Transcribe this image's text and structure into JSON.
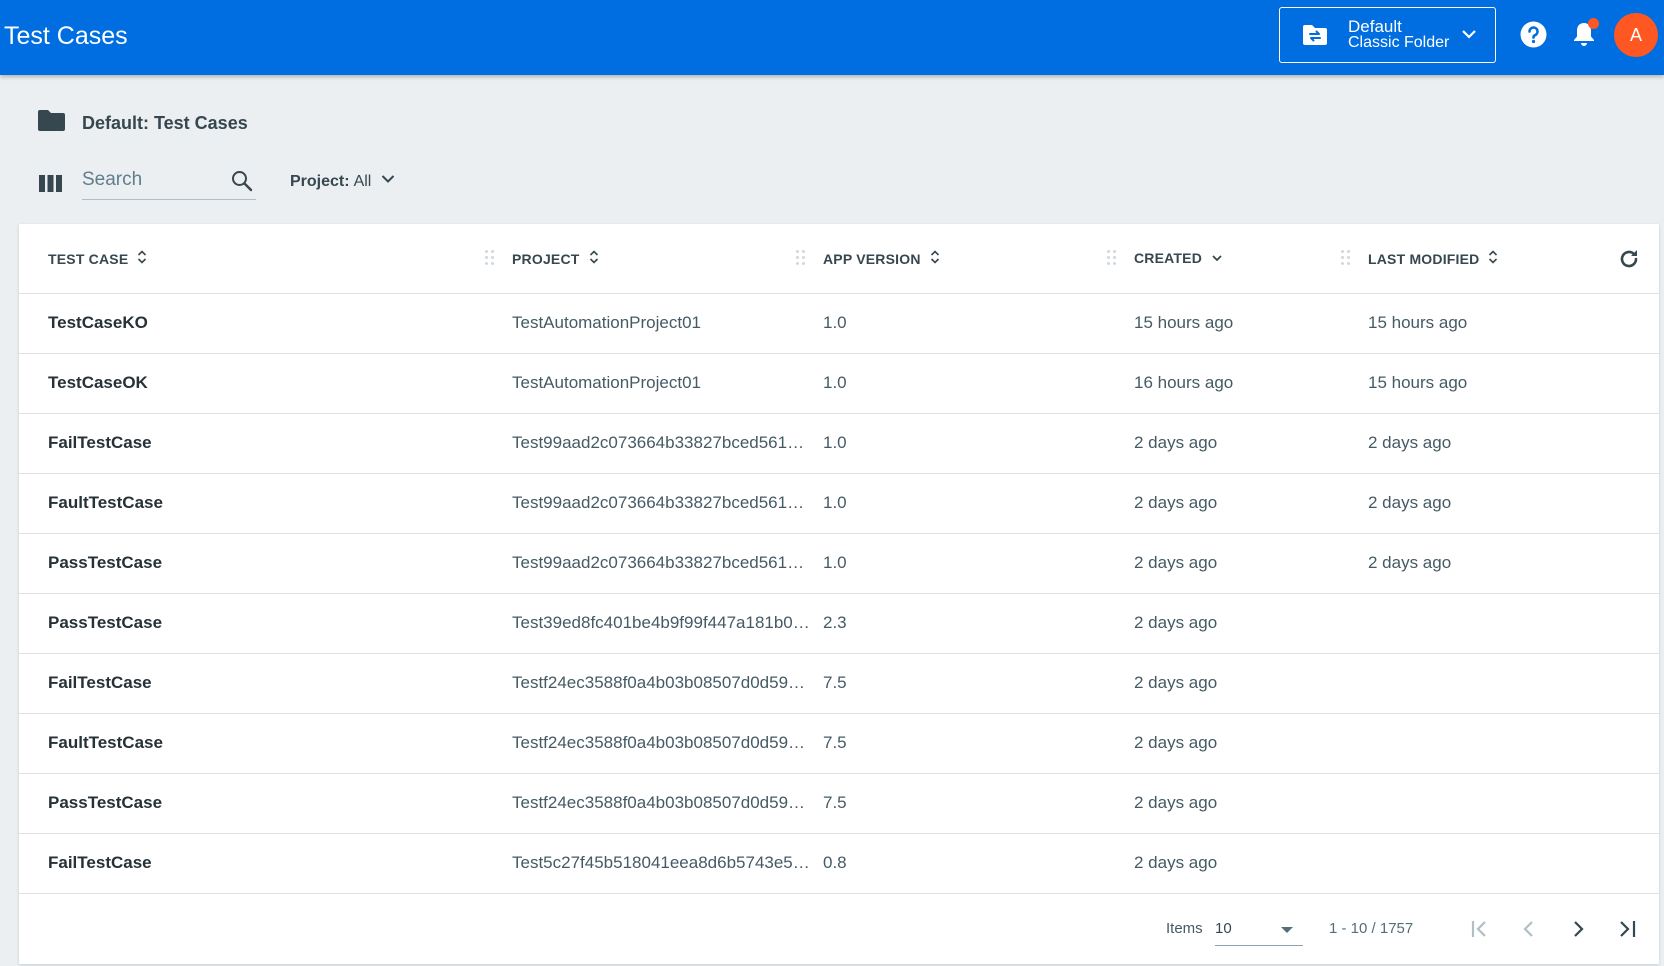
{
  "header": {
    "title": "Test Cases",
    "folder_switch": {
      "line1": "Default",
      "line2": "Classic Folder"
    },
    "avatar_initial": "A"
  },
  "breadcrumb": {
    "title": "Default: Test Cases"
  },
  "toolbar": {
    "search_placeholder": "Search",
    "project_filter_label": "Project:",
    "project_filter_value": "All"
  },
  "table": {
    "columns": {
      "test_case": "TEST CASE",
      "project": "PROJECT",
      "app_version": "APP VERSION",
      "created": "CREATED",
      "last_modified": "LAST MODIFIED"
    },
    "rows": [
      {
        "name": "TestCaseKO",
        "project": "TestAutomationProject01",
        "version": "1.0",
        "created": "15 hours ago",
        "modified": "15 hours ago"
      },
      {
        "name": "TestCaseOK",
        "project": "TestAutomationProject01",
        "version": "1.0",
        "created": "16 hours ago",
        "modified": "15 hours ago"
      },
      {
        "name": "FailTestCase",
        "project": "Test99aad2c073664b33827bced5615…",
        "version": "1.0",
        "created": "2 days ago",
        "modified": "2 days ago"
      },
      {
        "name": "FaultTestCase",
        "project": "Test99aad2c073664b33827bced5615…",
        "version": "1.0",
        "created": "2 days ago",
        "modified": "2 days ago"
      },
      {
        "name": "PassTestCase",
        "project": "Test99aad2c073664b33827bced5615…",
        "version": "1.0",
        "created": "2 days ago",
        "modified": "2 days ago"
      },
      {
        "name": "PassTestCase",
        "project": "Test39ed8fc401be4b9f99f447a181b0…",
        "version": "2.3",
        "created": "2 days ago",
        "modified": ""
      },
      {
        "name": "FailTestCase",
        "project": "Testf24ec3588f0a4b03b08507d0d59e…",
        "version": "7.5",
        "created": "2 days ago",
        "modified": ""
      },
      {
        "name": "FaultTestCase",
        "project": "Testf24ec3588f0a4b03b08507d0d59e…",
        "version": "7.5",
        "created": "2 days ago",
        "modified": ""
      },
      {
        "name": "PassTestCase",
        "project": "Testf24ec3588f0a4b03b08507d0d59e…",
        "version": "7.5",
        "created": "2 days ago",
        "modified": ""
      },
      {
        "name": "FailTestCase",
        "project": "Test5c27f45b518041eea8d6b5743e5f…",
        "version": "0.8",
        "created": "2 days ago",
        "modified": ""
      }
    ]
  },
  "pagination": {
    "items_label": "Items",
    "items_per_page": "10",
    "range": "1 - 10 / 1757"
  },
  "colors": {
    "header_bg": "#006ee0",
    "accent": "#ff5722",
    "page_bg": "#eceff1"
  },
  "icons": [
    "folder-switch-icon",
    "help-icon",
    "bell-icon",
    "folder-icon",
    "columns-icon",
    "search-icon",
    "chevron-down-icon",
    "sort-icon",
    "refresh-icon",
    "first-page-icon",
    "prev-page-icon",
    "next-page-icon",
    "last-page-icon"
  ]
}
